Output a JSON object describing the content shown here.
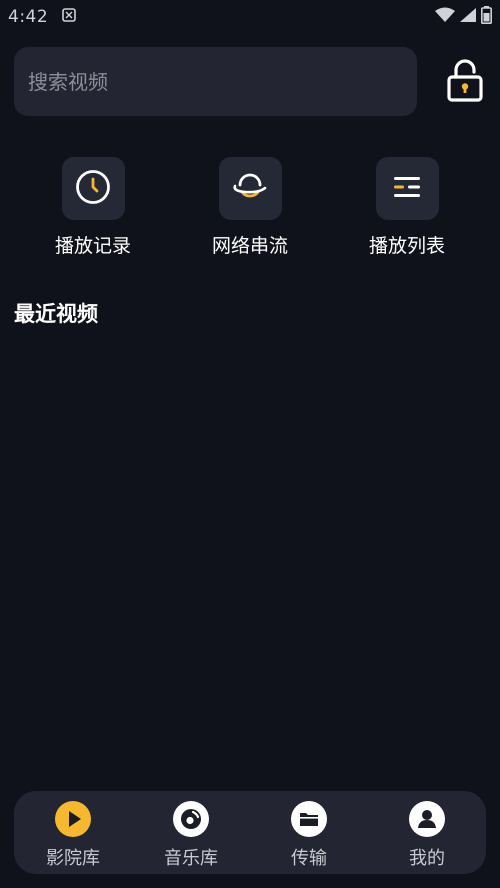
{
  "status_bar": {
    "time": "4:42"
  },
  "search": {
    "placeholder": "搜索视频"
  },
  "quick_actions": [
    {
      "label": "播放记录",
      "icon": "clock-icon"
    },
    {
      "label": "网络串流",
      "icon": "planet-icon"
    },
    {
      "label": "播放列表",
      "icon": "list-icon"
    }
  ],
  "section": {
    "title": "最近视频"
  },
  "bottom_nav": [
    {
      "label": "影院库",
      "icon": "play-icon",
      "active": true
    },
    {
      "label": "音乐库",
      "icon": "music-disc-icon",
      "active": false
    },
    {
      "label": "传输",
      "icon": "folder-icon",
      "active": false
    },
    {
      "label": "我的",
      "icon": "user-icon",
      "active": false
    }
  ],
  "colors": {
    "accent": "#f5b82e",
    "background": "#0f121a",
    "surface": "#232632"
  }
}
